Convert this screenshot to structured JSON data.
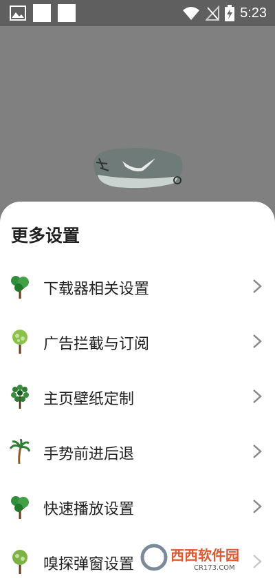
{
  "status_bar": {
    "time": "5:23",
    "icons": [
      "image-icon",
      "notification-square",
      "notification-square",
      "wifi-icon",
      "no-signal-icon",
      "battery-charging-icon"
    ]
  },
  "sheet": {
    "title": "更多设置",
    "items": [
      {
        "label": "下载器相关设置",
        "icon": "tree-icon"
      },
      {
        "label": "广告拦截与订阅",
        "icon": "tree-icon"
      },
      {
        "label": "主页壁纸定制",
        "icon": "tree-icon"
      },
      {
        "label": "手势前进后退",
        "icon": "palm-tree-icon"
      },
      {
        "label": "快速播放设置",
        "icon": "tree-icon"
      },
      {
        "label": "嗅探弹窗设置",
        "icon": "tree-icon"
      }
    ]
  },
  "watermark": {
    "text": "西西软件园",
    "subtext": "CR173.COM"
  },
  "colors": {
    "accent_green": "#2f8f3a",
    "trunk_brown": "#6b3a1a",
    "chevron": "#888888",
    "sheet_bg": "#ffffff",
    "backdrop": "#808080"
  }
}
